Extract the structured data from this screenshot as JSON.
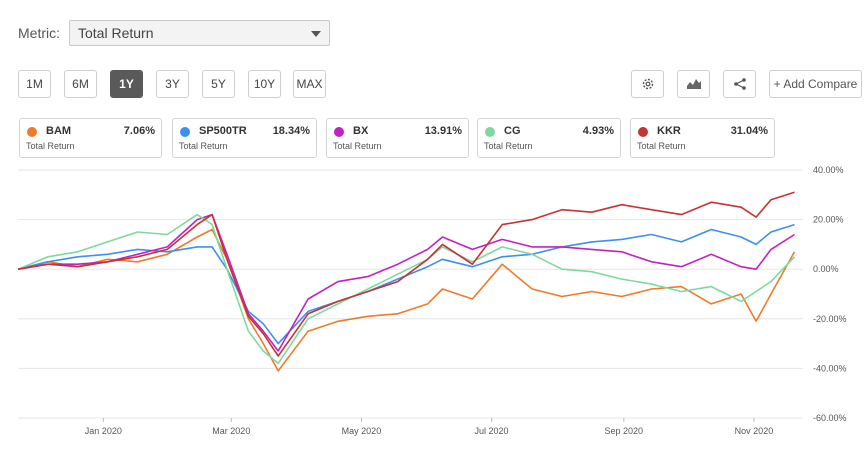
{
  "metric": {
    "label": "Metric:",
    "selected": "Total Return"
  },
  "ranges": [
    "1M",
    "6M",
    "1Y",
    "3Y",
    "5Y",
    "10Y",
    "MAX"
  ],
  "active_range": "1Y",
  "tools": {
    "settings_icon": "gear-icon",
    "chart_type_icon": "area-chart-icon",
    "share_icon": "share-icon",
    "add_compare": "+ Add Compare"
  },
  "legend": [
    {
      "ticker": "BAM",
      "value": "7.06%",
      "sub": "Total Return",
      "color": "#f07a2a"
    },
    {
      "ticker": "SP500TR",
      "value": "18.34%",
      "sub": "Total Return",
      "color": "#3d8ff2"
    },
    {
      "ticker": "BX",
      "value": "13.91%",
      "sub": "Total Return",
      "color": "#c222c2"
    },
    {
      "ticker": "CG",
      "value": "4.93%",
      "sub": "Total Return",
      "color": "#7ed9a0"
    },
    {
      "ticker": "KKR",
      "value": "31.04%",
      "sub": "Total Return",
      "color": "#c43434"
    }
  ],
  "chart_data": {
    "type": "line",
    "x": [
      "2019-11-22",
      "2019-12-06",
      "2019-12-20",
      "2020-01-03",
      "2020-01-17",
      "2020-01-31",
      "2020-02-14",
      "2020-02-21",
      "2020-02-28",
      "2020-03-09",
      "2020-03-16",
      "2020-03-23",
      "2020-04-06",
      "2020-04-20",
      "2020-05-04",
      "2020-05-18",
      "2020-06-01",
      "2020-06-08",
      "2020-06-22",
      "2020-07-06",
      "2020-07-20",
      "2020-08-03",
      "2020-08-17",
      "2020-08-31",
      "2020-09-14",
      "2020-09-28",
      "2020-10-12",
      "2020-10-26",
      "2020-11-02",
      "2020-11-09",
      "2020-11-20"
    ],
    "series": [
      {
        "name": "BAM",
        "values": [
          0,
          3,
          1,
          4,
          3,
          6,
          13,
          16,
          4,
          -20,
          -30,
          -41,
          -25,
          -21,
          -19,
          -18,
          -14,
          -8,
          -12,
          2,
          -8,
          -11,
          -9,
          -11,
          -8,
          -7,
          -14,
          -10,
          -21,
          -10,
          7
        ]
      },
      {
        "name": "SP500TR",
        "values": [
          0,
          3,
          5,
          6,
          8,
          7,
          9,
          9,
          0,
          -17,
          -22,
          -30,
          -17,
          -13,
          -9,
          -4,
          1,
          4,
          1,
          5,
          6,
          9,
          11,
          12,
          14,
          11,
          16,
          13,
          10,
          15,
          18
        ]
      },
      {
        "name": "BX",
        "values": [
          0,
          2,
          2,
          3,
          6,
          9,
          20,
          22,
          6,
          -18,
          -25,
          -33,
          -12,
          -5,
          -3,
          2,
          8,
          13,
          8,
          12,
          9,
          9,
          8,
          7,
          3,
          1,
          6,
          1,
          0,
          8,
          14
        ]
      },
      {
        "name": "CG",
        "values": [
          0,
          5,
          7,
          11,
          15,
          14,
          22,
          18,
          0,
          -25,
          -33,
          -38,
          -20,
          -14,
          -8,
          -2,
          4,
          9,
          3,
          9,
          6,
          0,
          -1,
          -4,
          -6,
          -9,
          -7,
          -13,
          -9,
          -5,
          5
        ]
      },
      {
        "name": "KKR",
        "values": [
          0,
          2,
          1,
          3,
          5,
          8,
          18,
          22,
          4,
          -19,
          -26,
          -35,
          -18,
          -13,
          -9,
          -5,
          4,
          10,
          2,
          18,
          20,
          24,
          23,
          26,
          24,
          22,
          27,
          25,
          21,
          28,
          31
        ]
      }
    ],
    "x_ticks": [
      {
        "date": "2020-01-01",
        "label": "Jan 2020"
      },
      {
        "date": "2020-03-01",
        "label": "Mar 2020"
      },
      {
        "date": "2020-05-01",
        "label": "May 2020"
      },
      {
        "date": "2020-07-01",
        "label": "Jul 2020"
      },
      {
        "date": "2020-09-01",
        "label": "Sep 2020"
      },
      {
        "date": "2020-11-01",
        "label": "Nov 2020"
      }
    ],
    "y_ticks": [
      40,
      20,
      0,
      -20,
      -40,
      -60
    ],
    "y_tick_labels": [
      "40.00%",
      "20.00%",
      "0.00%",
      "-20.00%",
      "-40.00%",
      "-60.00%"
    ],
    "xlim": [
      "2019-11-22",
      "2020-11-24"
    ],
    "ylim": [
      -60,
      40
    ],
    "grid": "horizontal",
    "ylabel_side": "right"
  }
}
